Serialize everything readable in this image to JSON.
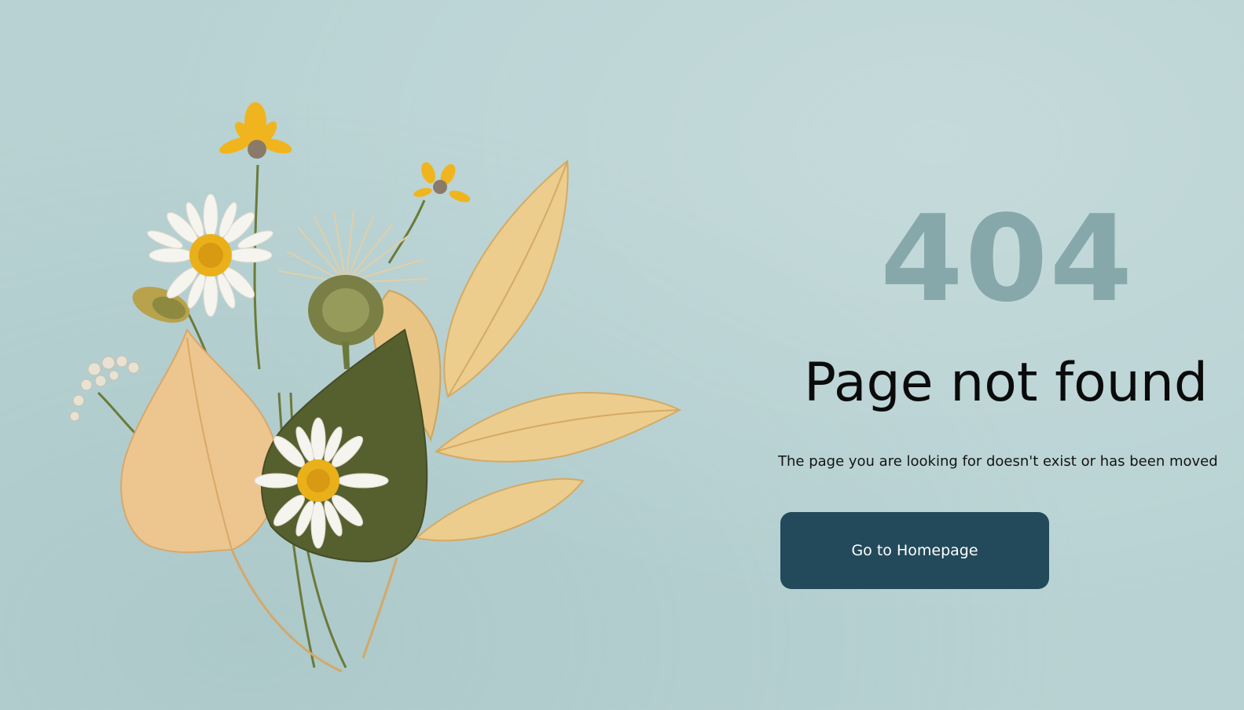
{
  "error": {
    "code": "404",
    "title": "Page not found",
    "message": "The page you are looking for doesn't exist or has been moved"
  },
  "actions": {
    "home_label": "Go to Homepage"
  },
  "colors": {
    "background": "#b8d2d3",
    "code_text": "#87a8aa",
    "button_bg": "#234a5b",
    "button_text": "#ffffff"
  },
  "illustration": {
    "subject": "pressed-flowers-bouquet-icon"
  }
}
